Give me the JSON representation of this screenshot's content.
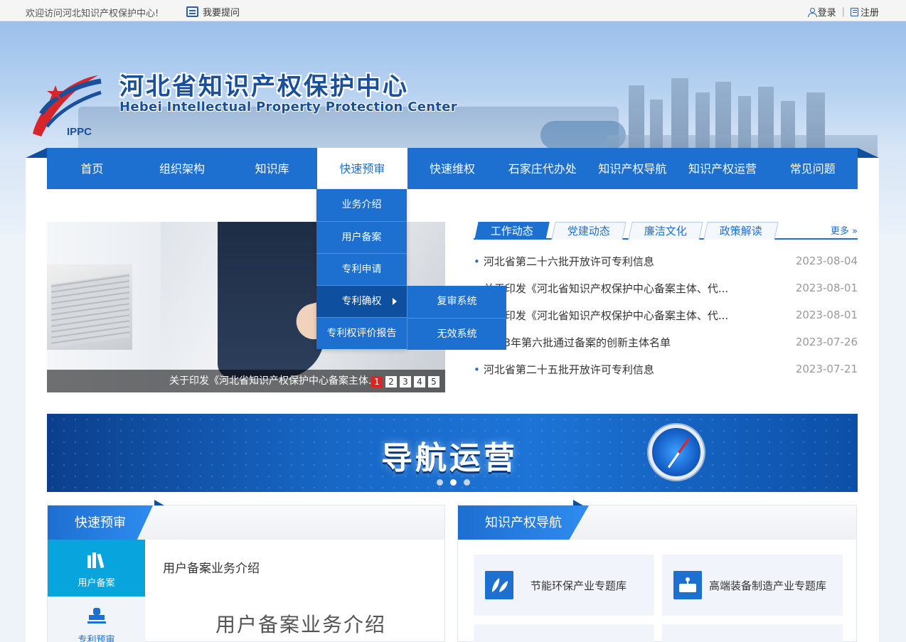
{
  "topbar": {
    "welcome": "欢迎访问河北知识产权保护中心!",
    "ask": "我要提问",
    "login": "登录",
    "register": "注册"
  },
  "header": {
    "title_cn": "河北省知识产权保护中心",
    "title_en": "Hebei Intellectual Property Protection Center",
    "logo_text": "IPPC"
  },
  "nav": {
    "items": [
      "首页",
      "组织架构",
      "知识库",
      "快速预审",
      "快速维权",
      "石家庄代办处",
      "知识产权导航",
      "知识产权运营",
      "常见问题"
    ],
    "active_index": 3
  },
  "dropdown": {
    "items": [
      "业务介绍",
      "用户备案",
      "专利申请",
      "专利确权",
      "专利权评价报告"
    ],
    "sub_items": [
      "复审系统",
      "无效系统"
    ]
  },
  "slider": {
    "caption": "关于印发《河北省知识产权保护中心备案主体...",
    "pages": [
      "1",
      "2",
      "3",
      "4",
      "5"
    ]
  },
  "news": {
    "tabs": [
      "工作动态",
      "党建动态",
      "廉洁文化",
      "政策解读"
    ],
    "more": "更多 »",
    "items": [
      {
        "title": "河北省第二十六批开放许可专利信息",
        "date": "2023-08-04"
      },
      {
        "title": "关于印发《河北省知识产权保护中心备案主体、代...",
        "date": "2023-08-01"
      },
      {
        "title": "关于印发《河北省知识产权保护中心备案主体、代...",
        "date": "2023-08-01"
      },
      {
        "title": "2023年第六批通过备案的创新主体名单",
        "date": "2023-07-26"
      },
      {
        "title": "河北省第二十五批开放许可专利信息",
        "date": "2023-07-21"
      }
    ]
  },
  "wide_banner": {
    "title": "导航运营"
  },
  "panel_left": {
    "title": "快速预审",
    "side": [
      "用户备案",
      "专利预审"
    ],
    "content_title": "用户备案业务介绍",
    "content_big": "用户备案业务介绍"
  },
  "panel_right": {
    "title": "知识产权导航",
    "tiles": [
      "节能环保产业专题库",
      "高端装备制造产业专题库"
    ]
  },
  "colors": {
    "primary": "#1d6fd0",
    "dark": "#0e4fa0",
    "accent_cyan": "#08a4dd",
    "active_red": "#e02323"
  }
}
